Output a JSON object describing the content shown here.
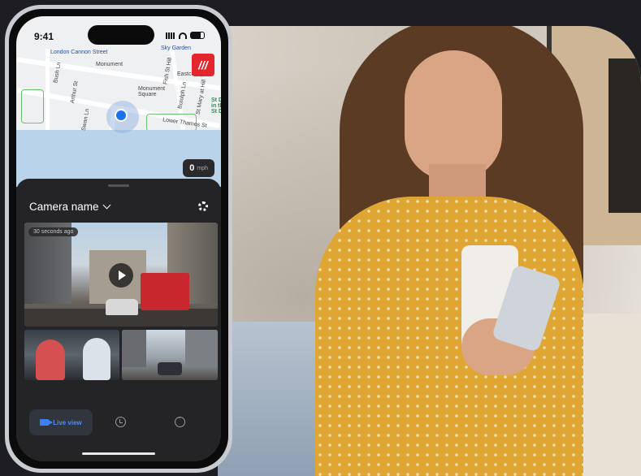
{
  "status_bar": {
    "time": "9:41"
  },
  "map": {
    "labels": {
      "london_cannon_street": "London Cannon Street",
      "sky_garden": "Sky Garden",
      "monument": "Monument",
      "eastcheap": "Eastcheap",
      "monument_square": "Monument\nSquare",
      "lower_thames_st": "Lower Thames St",
      "bush_ln": "Bush Ln",
      "arthur_st": "Arthur St",
      "swan_ln": "Swan Ln",
      "fish_st_hill": "Fish St Hill",
      "botolph_ln": "Botolph Ln",
      "st_mary_at_hill": "St Mary at Hill",
      "st_dunstan": "St Dun\nin the\nSt Du"
    },
    "logo": "///",
    "speed": {
      "value": "0",
      "unit": "mph"
    }
  },
  "sheet": {
    "camera_name": "Camera name",
    "main_video": {
      "badge": "30 seconds ago"
    }
  },
  "tabbar": {
    "live_view": "Live view"
  },
  "colors": {
    "accent_blue": "#4d8ef7",
    "logo_red": "#e3262d",
    "sheet_bg": "#242426"
  }
}
